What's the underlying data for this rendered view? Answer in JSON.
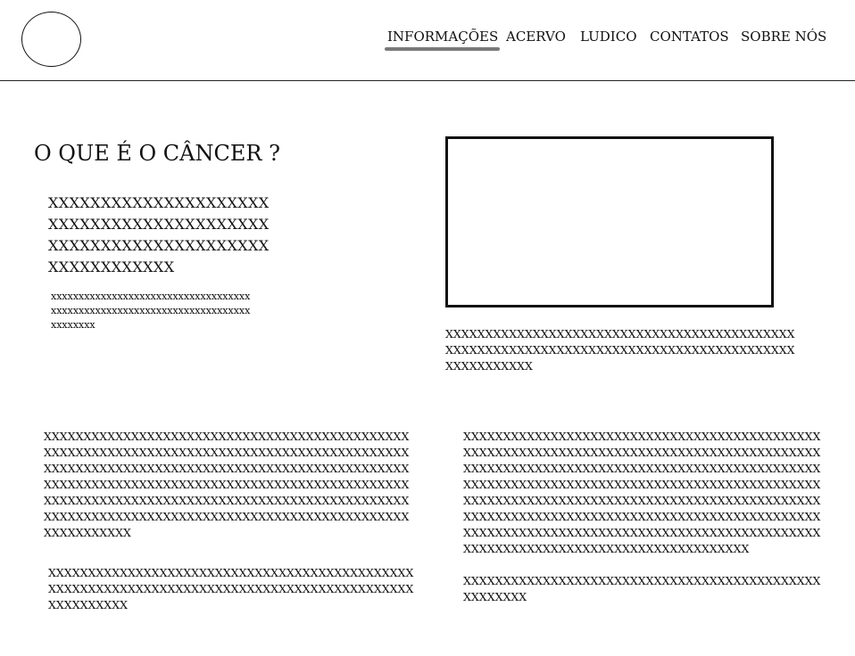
{
  "nav": {
    "items": [
      {
        "label": "INFORMAÇÕES"
      },
      {
        "label": "ACERVO"
      },
      {
        "label": "LUDICO"
      },
      {
        "label": "CONTATOS"
      },
      {
        "label": "SOBRE NÓS"
      }
    ],
    "active_item": "INFORMAÇÕES"
  },
  "main": {
    "title": "O QUE É O CÂNCER ?",
    "lead_lines": [
      "XXXXXXXXXXXXXXXXXXXXX",
      "XXXXXXXXXXXXXXXXXXXXX",
      "XXXXXXXXXXXXXXXXXXXXX",
      "XXXXXXXXXXXX"
    ],
    "small_lines": [
      "xxxxxxxxxxxxxxxxxxxxxxxxxxxxxxxxxxxx",
      "xxxxxxxxxxxxxxxxxxxxxxxxxxxxxxxxxxxx",
      "xxxxxxxx"
    ],
    "caption_lines": [
      "XXXXXXXXXXXXXXXXXXXXXXXXXXXXXXXXXXXXXXXXXXXX",
      "XXXXXXXXXXXXXXXXXXXXXXXXXXXXXXXXXXXXXXXXXXXX",
      "XXXXXXXXXXX"
    ],
    "para1_lines": [
      "XXXXXXXXXXXXXXXXXXXXXXXXXXXXXXXXXXXXXXXXXXXXXX",
      "XXXXXXXXXXXXXXXXXXXXXXXXXXXXXXXXXXXXXXXXXXXXXX",
      "XXXXXXXXXXXXXXXXXXXXXXXXXXXXXXXXXXXXXXXXXXXXXX",
      "XXXXXXXXXXXXXXXXXXXXXXXXXXXXXXXXXXXXXXXXXXXXXX",
      "XXXXXXXXXXXXXXXXXXXXXXXXXXXXXXXXXXXXXXXXXXXXXX",
      "XXXXXXXXXXXXXXXXXXXXXXXXXXXXXXXXXXXXXXXXXXXXXX",
      "XXXXXXXXXXX"
    ],
    "para2_lines": [
      "XXXXXXXXXXXXXXXXXXXXXXXXXXXXXXXXXXXXXXXXXXXXXX",
      "XXXXXXXXXXXXXXXXXXXXXXXXXXXXXXXXXXXXXXXXXXXXXX",
      "XXXXXXXXXX"
    ],
    "para3_lines": [
      "XXXXXXXXXXXXXXXXXXXXXXXXXXXXXXXXXXXXXXXXXXXXX",
      "XXXXXXXXXXXXXXXXXXXXXXXXXXXXXXXXXXXXXXXXXXXXX",
      "XXXXXXXXXXXXXXXXXXXXXXXXXXXXXXXXXXXXXXXXXXXXX",
      "XXXXXXXXXXXXXXXXXXXXXXXXXXXXXXXXXXXXXXXXXXXXX",
      "XXXXXXXXXXXXXXXXXXXXXXXXXXXXXXXXXXXXXXXXXXXXX",
      "XXXXXXXXXXXXXXXXXXXXXXXXXXXXXXXXXXXXXXXXXXXXX",
      "XXXXXXXXXXXXXXXXXXXXXXXXXXXXXXXXXXXXXXXXXXXXX",
      "XXXXXXXXXXXXXXXXXXXXXXXXXXXXXXXXXXXX"
    ],
    "para4_lines": [
      "XXXXXXXXXXXXXXXXXXXXXXXXXXXXXXXXXXXXXXXXXXXXX",
      "XXXXXXXX"
    ]
  }
}
